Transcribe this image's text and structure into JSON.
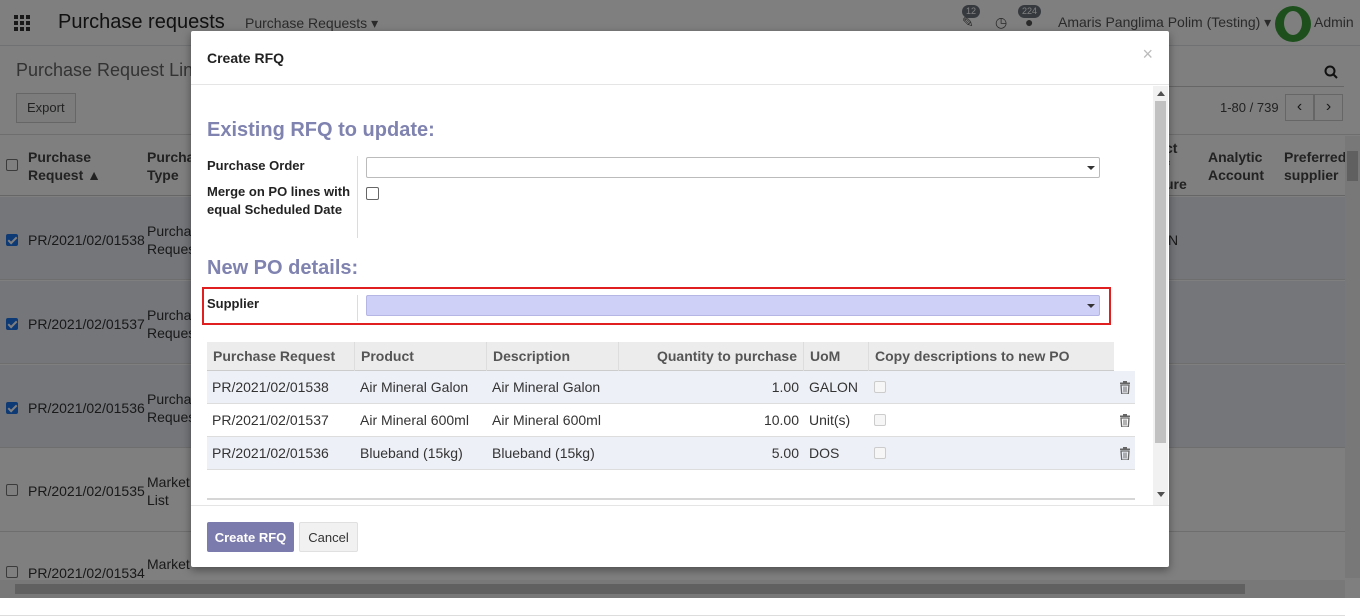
{
  "navbar": {
    "app_title": "Purchase requests",
    "menu": "Purchase Requests",
    "activity_badge": "12",
    "messages_badge": "224",
    "company": "Amaris Panglima Polim (Testing)",
    "user": "Admin"
  },
  "control_panel": {
    "breadcrumb": "Purchase Request Lin",
    "export_label": "Export",
    "pager_text": "1-80 / 739",
    "prev": "‹",
    "next": "›"
  },
  "list": {
    "headers": {
      "purchase_request": "Purchase Request ▲",
      "purchase_type": "Purcha Type",
      "product_measure_part": "ct f ure",
      "analytic_account": "Analytic Account",
      "preferred_supplier": "Preferred supplier"
    },
    "rows": [
      {
        "request": "PR/2021/02/01538",
        "type": "Purchas Reques",
        "extra": "N",
        "checked": true
      },
      {
        "request": "PR/2021/02/01537",
        "type": "Purchas Reques",
        "extra": "",
        "checked": true
      },
      {
        "request": "PR/2021/02/01536",
        "type": "Purchas Reques",
        "extra": "",
        "checked": true
      },
      {
        "request": "PR/2021/02/01535",
        "type": "Market List",
        "extra": "",
        "checked": false
      },
      {
        "request": "PR/2021/02/01534",
        "type": "Market",
        "extra": "",
        "checked": false
      }
    ]
  },
  "modal": {
    "title": "Create RFQ",
    "close": "×",
    "section_existing": "Existing RFQ to update:",
    "label_purchase_order": "Purchase Order",
    "label_merge": "Merge on PO lines with equal Scheduled Date",
    "section_new": "New PO details:",
    "label_supplier": "Supplier",
    "table": {
      "headers": [
        "Purchase Request",
        "Product",
        "Description",
        "Quantity to purchase",
        "UoM",
        "Copy descriptions to new PO"
      ],
      "rows": [
        {
          "request": "PR/2021/02/01538",
          "product": "Air Mineral Galon",
          "description": "Air Mineral Galon",
          "qty": "1.00",
          "uom": "GALON"
        },
        {
          "request": "PR/2021/02/01537",
          "product": "Air Mineral 600ml",
          "description": "Air Mineral 600ml",
          "qty": "10.00",
          "uom": "Unit(s)"
        },
        {
          "request": "PR/2021/02/01536",
          "product": "Blueband (15kg)",
          "description": "Blueband (15kg)",
          "qty": "5.00",
          "uom": "DOS"
        }
      ]
    },
    "create_label": "Create RFQ",
    "cancel_label": "Cancel"
  },
  "colors": {
    "accent": "#7c7bad",
    "section_title": "#8083b0",
    "required_field": "#cfd0f7",
    "highlight_box": "#e02020"
  }
}
